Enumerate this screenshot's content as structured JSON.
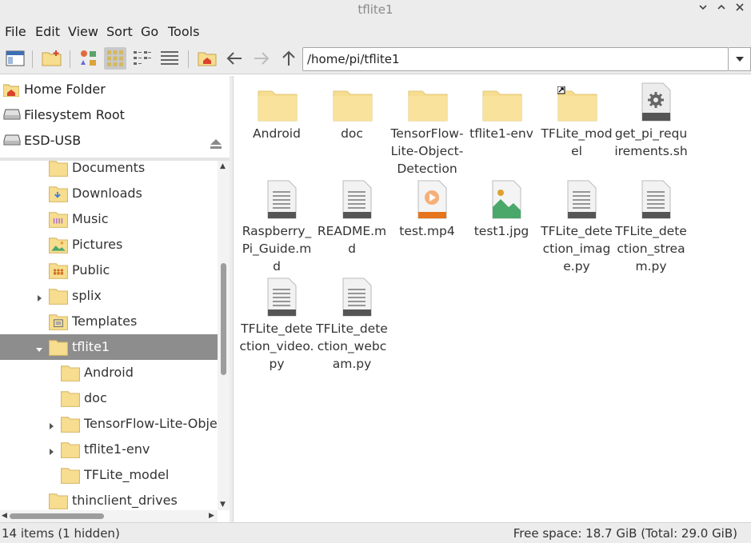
{
  "window": {
    "title": "tflite1"
  },
  "menu": [
    "File",
    "Edit",
    "View",
    "Sort",
    "Go",
    "Tools"
  ],
  "toolbar": {
    "path": "/home/pi/tflite1"
  },
  "places": [
    {
      "label": "Home Folder",
      "icon": "home-folder-icon"
    },
    {
      "label": "Filesystem Root",
      "icon": "drive-icon"
    },
    {
      "label": "ESD-USB",
      "icon": "usb-drive-icon"
    }
  ],
  "tree": [
    {
      "label": "Documents",
      "icon": "documents-folder-icon"
    },
    {
      "label": "Downloads",
      "icon": "downloads-folder-icon"
    },
    {
      "label": "Music",
      "icon": "music-folder-icon"
    },
    {
      "label": "Pictures",
      "icon": "pictures-folder-icon"
    },
    {
      "label": "Public",
      "icon": "public-folder-icon"
    },
    {
      "label": "splix",
      "icon": "folder-icon",
      "expander": "collapsed"
    },
    {
      "label": "Templates",
      "icon": "templates-folder-icon"
    },
    {
      "label": "tflite1",
      "icon": "folder-icon",
      "expander": "expanded",
      "selected": true
    },
    {
      "label": "Android",
      "icon": "folder-icon"
    },
    {
      "label": "doc",
      "icon": "folder-icon"
    },
    {
      "label": "TensorFlow-Lite-Object-",
      "icon": "folder-icon",
      "expander": "collapsed"
    },
    {
      "label": "tflite1-env",
      "icon": "folder-icon",
      "expander": "collapsed"
    },
    {
      "label": "TFLite_model",
      "icon": "folder-icon"
    },
    {
      "label": "thinclient_drives",
      "icon": "folder-icon"
    }
  ],
  "files": [
    {
      "name": "Android",
      "type": "folder"
    },
    {
      "name": "doc",
      "type": "folder"
    },
    {
      "name": "TensorFlow-Lite-Object-Detection-...",
      "type": "folder"
    },
    {
      "name": "tflite1-env",
      "type": "folder"
    },
    {
      "name": "TFLite_model",
      "type": "folder-link"
    },
    {
      "name": "get_pi_requirements.sh",
      "type": "script"
    },
    {
      "name": "Raspberry_Pi_Guide.md",
      "type": "text"
    },
    {
      "name": "README.md",
      "type": "text"
    },
    {
      "name": "test.mp4",
      "type": "video"
    },
    {
      "name": "test1.jpg",
      "type": "image"
    },
    {
      "name": "TFLite_detection_image.py",
      "type": "text"
    },
    {
      "name": "TFLite_detection_stream.py",
      "type": "text"
    },
    {
      "name": "TFLite_detection_video.py",
      "type": "text"
    },
    {
      "name": "TFLite_detection_webcam.py",
      "type": "text"
    }
  ],
  "status": {
    "items": "14 items (1 hidden)",
    "free_space": "Free space: 18.7 GiB (Total: 29.0 GiB)"
  },
  "colors": {
    "folder": "#f6dd8f",
    "selection": "#8d8d8d",
    "home": "#d9432c"
  }
}
